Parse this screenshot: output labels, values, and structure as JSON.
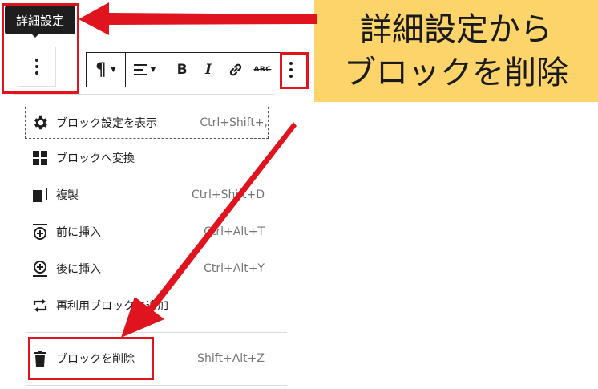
{
  "tooltip": {
    "text": "詳細設定"
  },
  "callout": {
    "line1": "詳細設定から",
    "line2": "ブロックを削除"
  },
  "toolbar": {
    "paragraph_icon": "¶",
    "align_icon": "align-left-icon",
    "bold_label": "B",
    "italic_label": "I",
    "link_icon": "link-icon",
    "strike_label": "ABC",
    "more_icon": "more-vertical-icon"
  },
  "menu": {
    "items": [
      {
        "icon": "gear-icon",
        "label": "ブロック設定を表示",
        "shortcut": "Ctrl+Shift+,"
      },
      {
        "icon": "grid-icon",
        "label": "ブロックへ変換",
        "shortcut": ""
      },
      {
        "icon": "duplicate-icon",
        "label": "複製",
        "shortcut": "Ctrl+Shift+D"
      },
      {
        "icon": "insert-before-icon",
        "label": "前に挿入",
        "shortcut": "Ctrl+Alt+T"
      },
      {
        "icon": "insert-after-icon",
        "label": "後に挿入",
        "shortcut": "Ctrl+Alt+Y"
      },
      {
        "icon": "reusable-icon",
        "label": "再利用ブロックに追加",
        "shortcut": ""
      }
    ],
    "delete": {
      "icon": "trash-icon",
      "label": "ブロックを削除",
      "shortcut": "Shift+Alt+Z"
    }
  },
  "colors": {
    "highlight": "#e0141e",
    "callout_bg": "#fcd46a",
    "arrow": "#e0141e"
  }
}
